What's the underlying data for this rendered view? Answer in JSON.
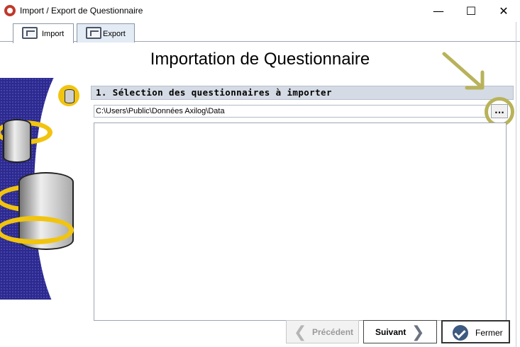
{
  "window": {
    "title": "Import / Export de Questionnaire",
    "minimize_glyph": "—",
    "maximize_glyph": "☐",
    "close_glyph": "✕"
  },
  "tabs": [
    {
      "label": "Import",
      "icon": "import-icon",
      "active": true
    },
    {
      "label": "Export",
      "icon": "export-icon",
      "active": false
    }
  ],
  "page_title": "Importation de Questionnaire",
  "section": {
    "header": "1. Sélection des questionnaires à importer"
  },
  "path_field": {
    "value": "C:\\Users\\Public\\Données Axilog\\Data"
  },
  "browse_button": {
    "label": "..."
  },
  "buttons": {
    "previous": "Précédent",
    "next": "Suivant",
    "close": "Fermer"
  },
  "colors": {
    "annotation": "#b8b35a",
    "header_bg": "#d5dbe4"
  }
}
